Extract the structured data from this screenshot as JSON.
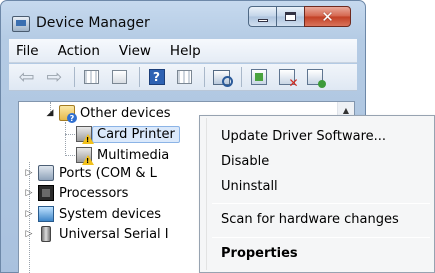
{
  "window": {
    "title": "Device Manager"
  },
  "menubar": {
    "items": [
      "File",
      "Action",
      "View",
      "Help"
    ]
  },
  "toolbar": {
    "buttons": [
      "back-icon",
      "forward-icon",
      "properties-grid-icon",
      "show-hidden-icon",
      "help-icon",
      "view-icon",
      "scan-hardware-icon",
      "update-driver-icon",
      "uninstall-icon",
      "enable-device-icon"
    ]
  },
  "tree": {
    "other_devices": "Other devices",
    "card_printer": "Card Printer",
    "multimedia": "Multimedia",
    "ports": "Ports (COM & L",
    "processors": "Processors",
    "system_devices": "System devices",
    "usb": "Universal Serial I"
  },
  "context_menu": {
    "update_driver": "Update Driver Software...",
    "disable": "Disable",
    "uninstall": "Uninstall",
    "scan": "Scan for hardware changes",
    "properties": "Properties"
  },
  "colors": {
    "title_bar": "#b4cbe4",
    "close_button": "#c23f24",
    "selection": "#dbe9fb"
  }
}
